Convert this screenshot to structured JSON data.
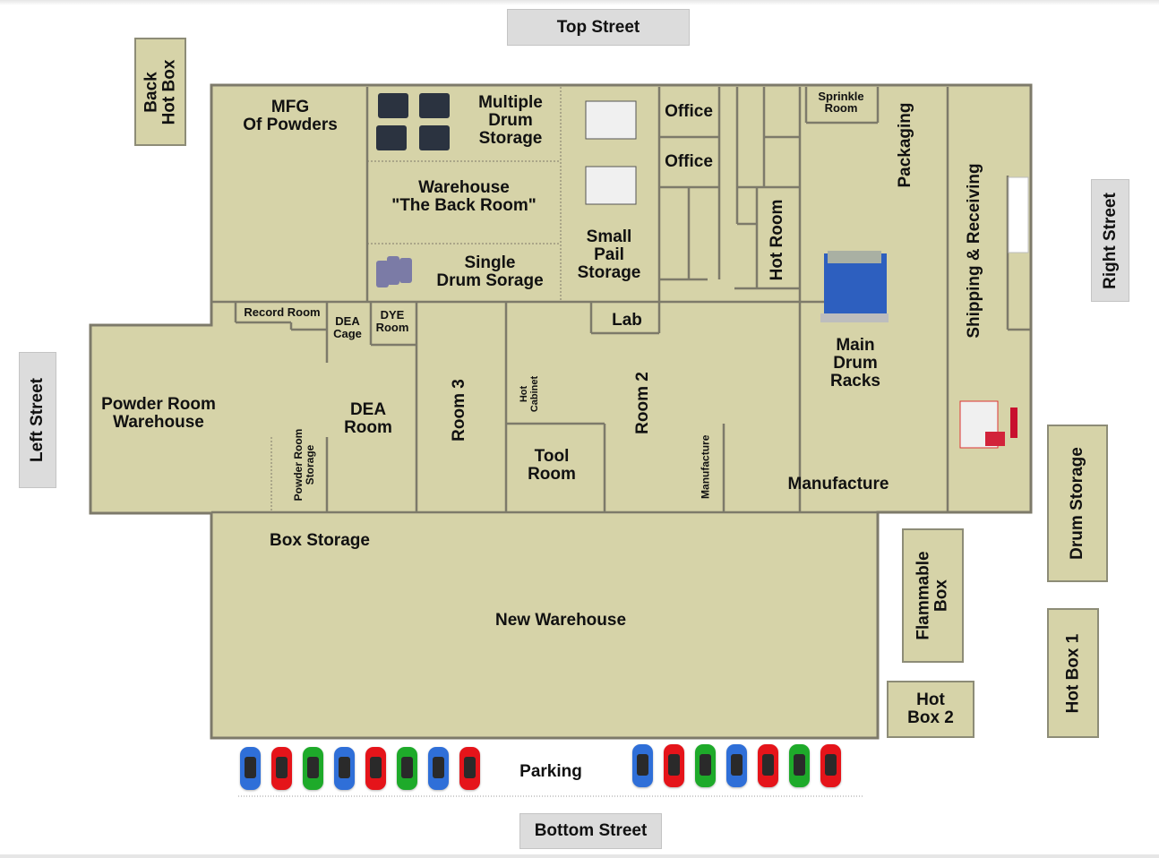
{
  "streets": {
    "top": "Top Street",
    "bottom": "Bottom Street",
    "left": "Left Street",
    "right": "Right Street"
  },
  "outbuildings": {
    "back_hot_box": [
      "Back",
      "Hot Box"
    ],
    "drum_storage": "Drum Storage",
    "flammable_box": [
      "Flammable",
      "Box"
    ],
    "hot_box_1": "Hot Box 1",
    "hot_box_2": [
      "Hot",
      "Box 2"
    ]
  },
  "rooms": {
    "mfg_powders": [
      "MFG",
      "Of Powders"
    ],
    "multiple_drum_storage": [
      "Multiple",
      "Drum",
      "Storage"
    ],
    "warehouse_back_room": [
      "Warehouse",
      "\"The Back Room\""
    ],
    "single_drum_storage": [
      "Single",
      "Drum Sorage"
    ],
    "small_pail_storage": [
      "Small",
      "Pail",
      "Storage"
    ],
    "office_1": "Office",
    "office_2": "Office",
    "sprinkle_room": [
      "Sprinkle",
      "Room"
    ],
    "packaging": "Packaging",
    "shipping_receiving": "Shipping & Receiving",
    "hot_room": "Hot Room",
    "lab": "Lab",
    "main_drum_racks": [
      "Main",
      "Drum",
      "Racks"
    ],
    "record_room": "Record Room",
    "dea_cage": [
      "DEA",
      "Cage"
    ],
    "dye_room": [
      "DYE",
      "Room"
    ],
    "powder_room_warehouse": [
      "Powder Room",
      "Warehouse"
    ],
    "powder_room_storage": [
      "Powder Room",
      "Storage"
    ],
    "dea_room": [
      "DEA",
      "Room"
    ],
    "room_3": "Room 3",
    "hot_cabinet": [
      "Hot",
      "Cabinet"
    ],
    "tool_room": [
      "Tool",
      "Room"
    ],
    "room_2": "Room 2",
    "manufacture_small": "Manufacture",
    "manufacture": "Manufacture",
    "box_storage": "Box Storage",
    "new_warehouse": "New Warehouse"
  },
  "parking": {
    "label": "Parking",
    "left_cars": [
      "blue",
      "red",
      "green",
      "blue",
      "red",
      "green",
      "blue",
      "red"
    ],
    "right_cars": [
      "blue",
      "red",
      "green",
      "blue",
      "red",
      "green",
      "red"
    ]
  },
  "colors": {
    "floor": "#d6d3a8",
    "wall": "#7d7a6a",
    "street_bg": "#dcdcdc",
    "car_blue": "#2f6fd8",
    "car_red": "#e5141a",
    "car_green": "#1eaa2a"
  }
}
